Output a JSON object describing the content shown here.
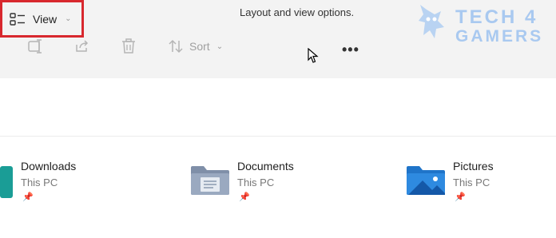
{
  "toolbar": {
    "tooltip": "Layout and view options.",
    "sort_label": "Sort",
    "view_label": "View",
    "more_label": "•••",
    "icons": [
      "rename-icon",
      "share-icon",
      "delete-icon",
      "sort-icon",
      "view-icon",
      "chevron-down-icon",
      "more-icon"
    ]
  },
  "brand": {
    "line1": "TECH 4",
    "line2": "GAMERS"
  },
  "folders": [
    {
      "name": "Downloads",
      "location": "This PC",
      "icon": "downloads-folder-icon"
    },
    {
      "name": "Documents",
      "location": "This PC",
      "icon": "documents-folder-icon"
    },
    {
      "name": "Pictures",
      "location": "This PC",
      "icon": "pictures-folder-icon"
    }
  ],
  "colors": {
    "highlight_box": "#d8282e",
    "toolbar_bg": "#f3f3f3",
    "brand": "#a9c9f0"
  }
}
